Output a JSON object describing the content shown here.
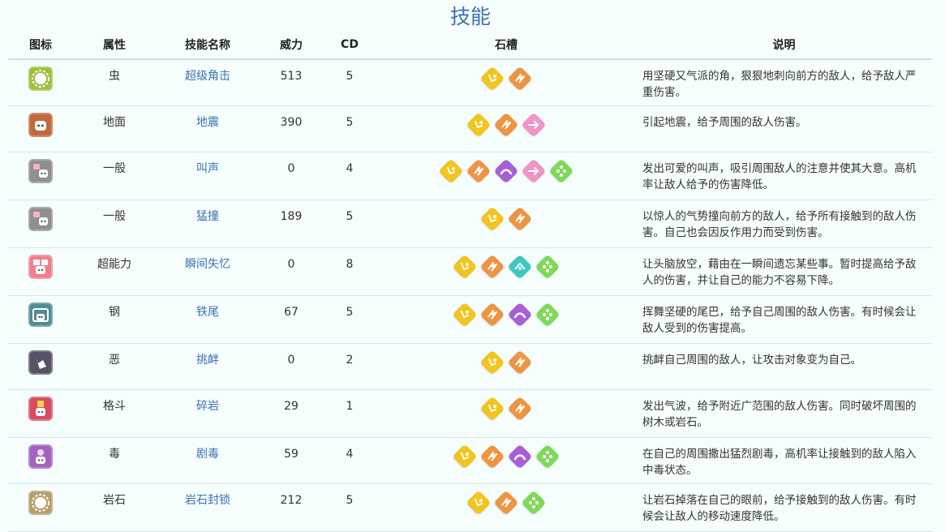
{
  "title": "技能",
  "headers": {
    "icon": "图标",
    "type": "属性",
    "name": "技能名称",
    "power": "威力",
    "cd": "CD",
    "slots": "石槽",
    "desc": "说明"
  },
  "colors": {
    "title": "#3d72b3",
    "link": "#3d72b3",
    "gem_yellow": "#f2c51e",
    "gem_orange": "#ef9440",
    "gem_pink": "#f293c8",
    "gem_purple": "#a65fd6",
    "gem_teal": "#3fc7c0",
    "gem_green": "#7ed957"
  },
  "skills": [
    {
      "type": "虫",
      "name": "超级角击",
      "power": "513",
      "cd": "5",
      "icon": "bug-type-icon",
      "icon_color": "#9bc03a",
      "slots": [
        "yellow",
        "orange"
      ],
      "desc": "用坚硬又气派的角，狠狠地刺向前方的敌人，给予敌人严重伤害。"
    },
    {
      "type": "地面",
      "name": "地震",
      "power": "390",
      "cd": "5",
      "icon": "ground-type-icon",
      "icon_color": "#c06a3c",
      "slots": [
        "yellow",
        "orange",
        "pink"
      ],
      "desc": "引起地震，给予周围的敌人伤害。"
    },
    {
      "type": "一般",
      "name": "叫声",
      "power": "0",
      "cd": "4",
      "icon": "normal-type-icon",
      "icon_color": "#8f8f8f",
      "slots": [
        "yellow",
        "orange",
        "purple",
        "pink",
        "green"
      ],
      "desc": "发出可爱的叫声，吸引周围敌人的注意并使其大意。高机率让敌人给予的伤害降低。"
    },
    {
      "type": "一般",
      "name": "猛撞",
      "power": "189",
      "cd": "5",
      "icon": "normal-type-icon",
      "icon_color": "#8f8f8f",
      "slots": [
        "yellow",
        "orange"
      ],
      "desc": "以惊人的气势撞向前方的敌人，给予所有接触到的敌人伤害。自己也会因反作用力而受到伤害。"
    },
    {
      "type": "超能力",
      "name": "瞬间失忆",
      "power": "0",
      "cd": "8",
      "icon": "psychic-type-icon",
      "icon_color": "#ee7f8e",
      "slots": [
        "yellow",
        "orange",
        "teal",
        "green"
      ],
      "desc": "让头脑放空，藉由在一瞬间遗忘某些事。暂时提高给予敌人的伤害，并让自己的能力不容易下降。"
    },
    {
      "type": "钢",
      "name": "铁尾",
      "power": "67",
      "cd": "5",
      "icon": "steel-type-icon",
      "icon_color": "#4f8b95",
      "slots": [
        "yellow",
        "orange",
        "purple",
        "green"
      ],
      "desc": "挥舞坚硬的尾巴，给予自己周围的敌人伤害。有时候会让敌人受到的伤害提高。"
    },
    {
      "type": "恶",
      "name": "挑衅",
      "power": "0",
      "cd": "2",
      "icon": "dark-type-icon",
      "icon_color": "#565366",
      "slots": [
        "yellow",
        "orange"
      ],
      "desc": "挑衅自己周围的敌人，让攻击对象变为自己。"
    },
    {
      "type": "格斗",
      "name": "碎岩",
      "power": "29",
      "cd": "1",
      "icon": "fighting-type-icon",
      "icon_color": "#d94a5e",
      "slots": [
        "yellow",
        "orange"
      ],
      "desc": "发出气波，给予附近广范围的敌人伤害。同时破坏周围的树木或岩石。"
    },
    {
      "type": "毒",
      "name": "剧毒",
      "power": "59",
      "cd": "4",
      "icon": "poison-type-icon",
      "icon_color": "#a263c0",
      "slots": [
        "yellow",
        "orange",
        "purple",
        "green"
      ],
      "desc": "在自己的周围撒出猛烈剧毒，高机率让接触到的敌人陷入中毒状态。"
    },
    {
      "type": "岩石",
      "name": "岩石封锁",
      "power": "212",
      "cd": "5",
      "icon": "rock-type-icon",
      "icon_color": "#b59c6a",
      "slots": [
        "yellow",
        "orange",
        "green"
      ],
      "desc": "让岩石掉落在自己的眼前，给予接触到的敌人伤害。有时候会让敌人的移动速度降低。"
    }
  ]
}
